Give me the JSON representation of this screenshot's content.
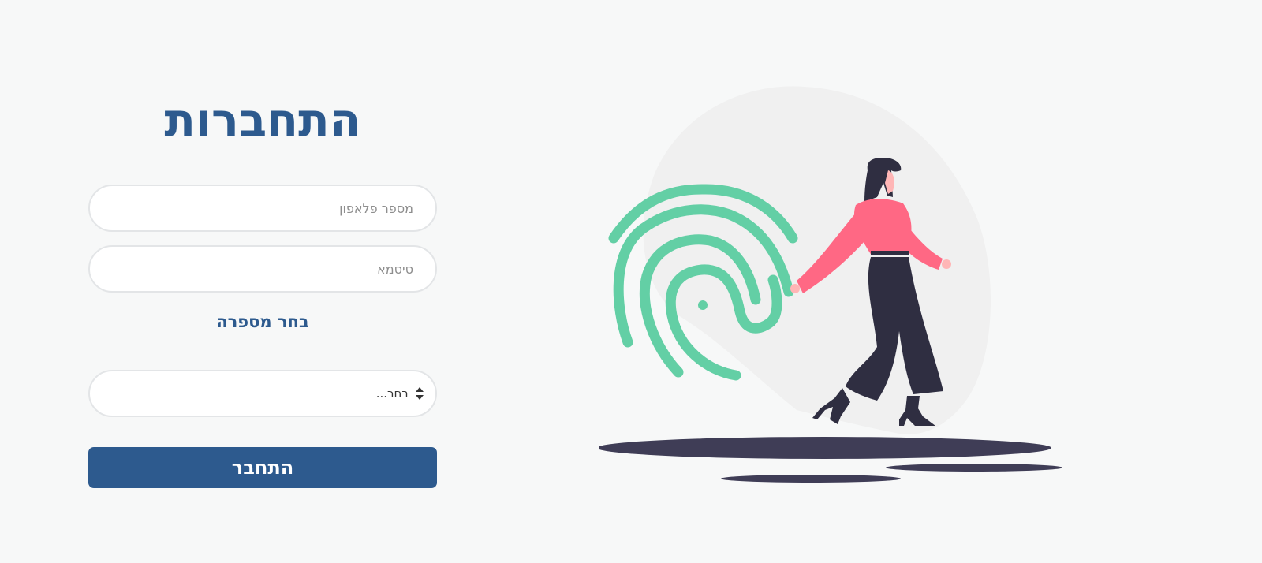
{
  "login": {
    "title": "התחברות",
    "phone_placeholder": "מספר פלאפון",
    "password_placeholder": "סיסמא",
    "salon_label": "בחר מספרה",
    "salon_select_value": "בחר...",
    "submit_label": "התחבר"
  },
  "colors": {
    "primary": "#2d5a8e",
    "fingerprint": "#63cfa5",
    "accent_pink": "#ff6884",
    "dark": "#2f2e41"
  },
  "illustration": {
    "icon": "fingerprint-icon"
  }
}
